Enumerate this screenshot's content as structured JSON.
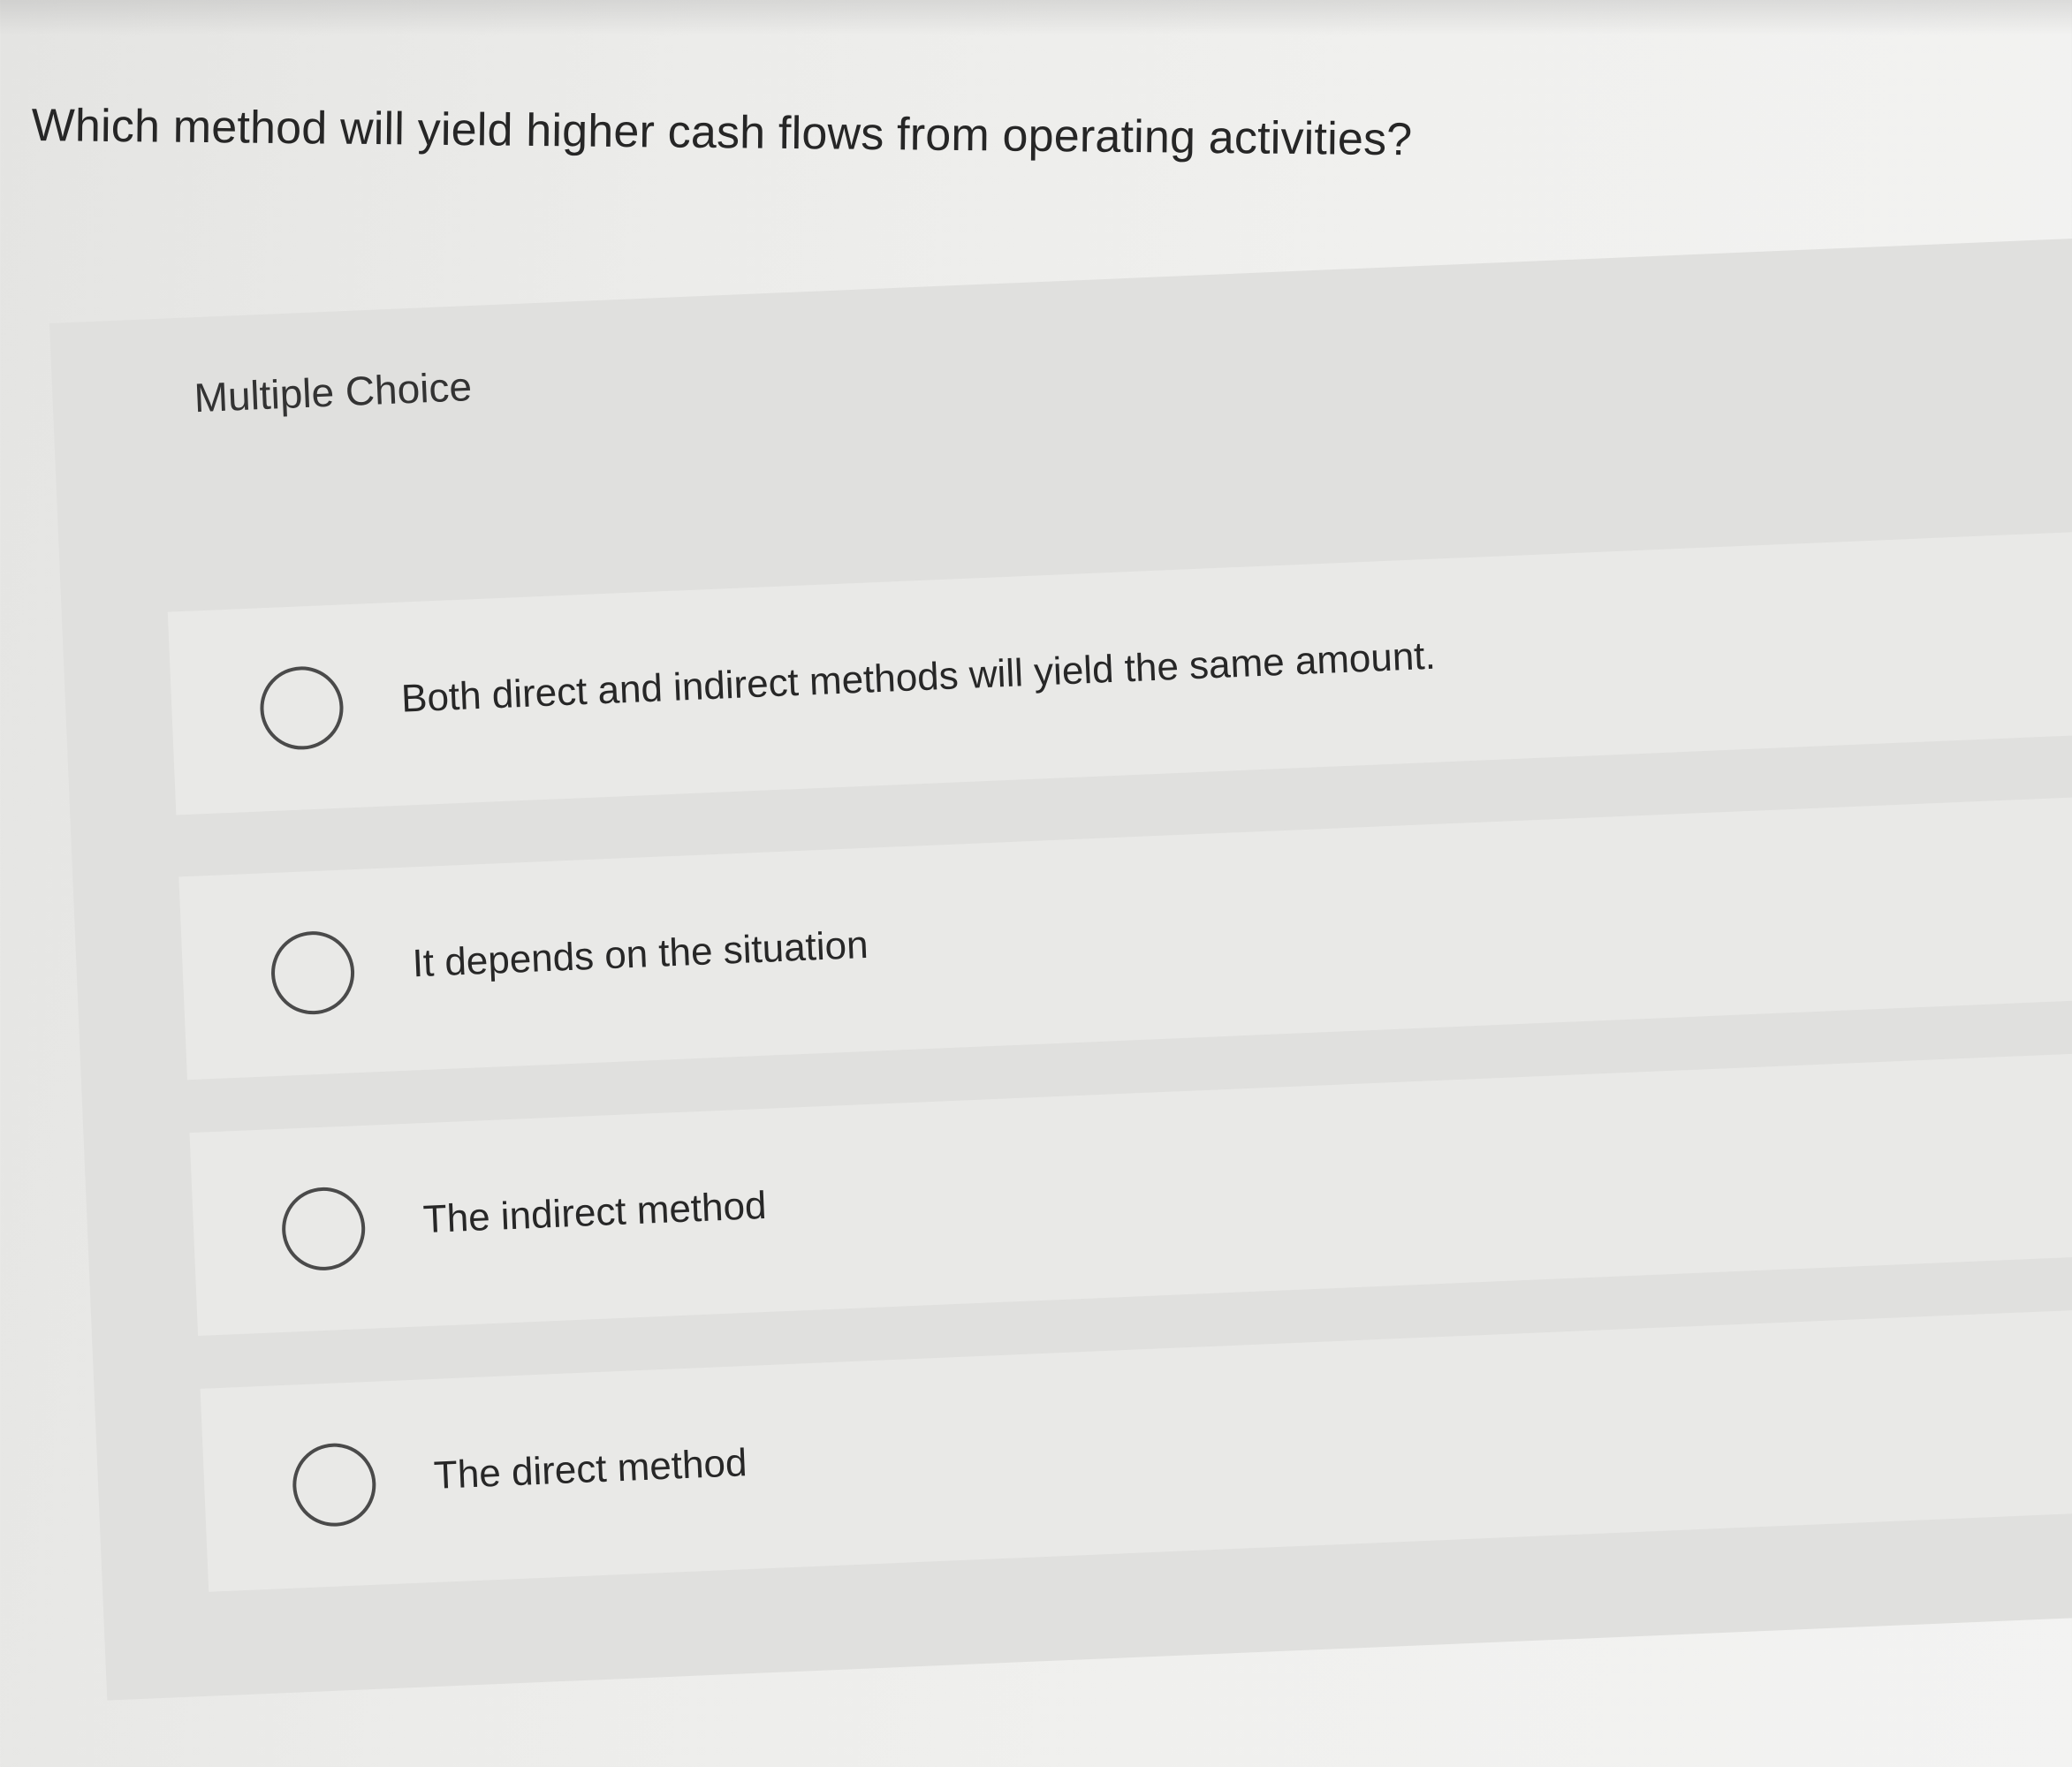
{
  "question": {
    "text": "Which method will yield higher cash flows from operating activities?"
  },
  "multiple_choice": {
    "label": "Multiple Choice",
    "options": [
      {
        "label": "Both direct and indirect methods will yield the same amount.",
        "selected": false
      },
      {
        "label": "It depends on the situation",
        "selected": false
      },
      {
        "label": "The indirect method",
        "selected": false
      },
      {
        "label": "The direct method",
        "selected": false
      }
    ]
  },
  "colors": {
    "background": "#ececea",
    "panel": "#e0e0de",
    "option_row": "#e9e9e7",
    "text": "#262626",
    "radio_border": "#4a4a4a"
  },
  "icons": {
    "radio": "radio-unchecked-icon"
  }
}
